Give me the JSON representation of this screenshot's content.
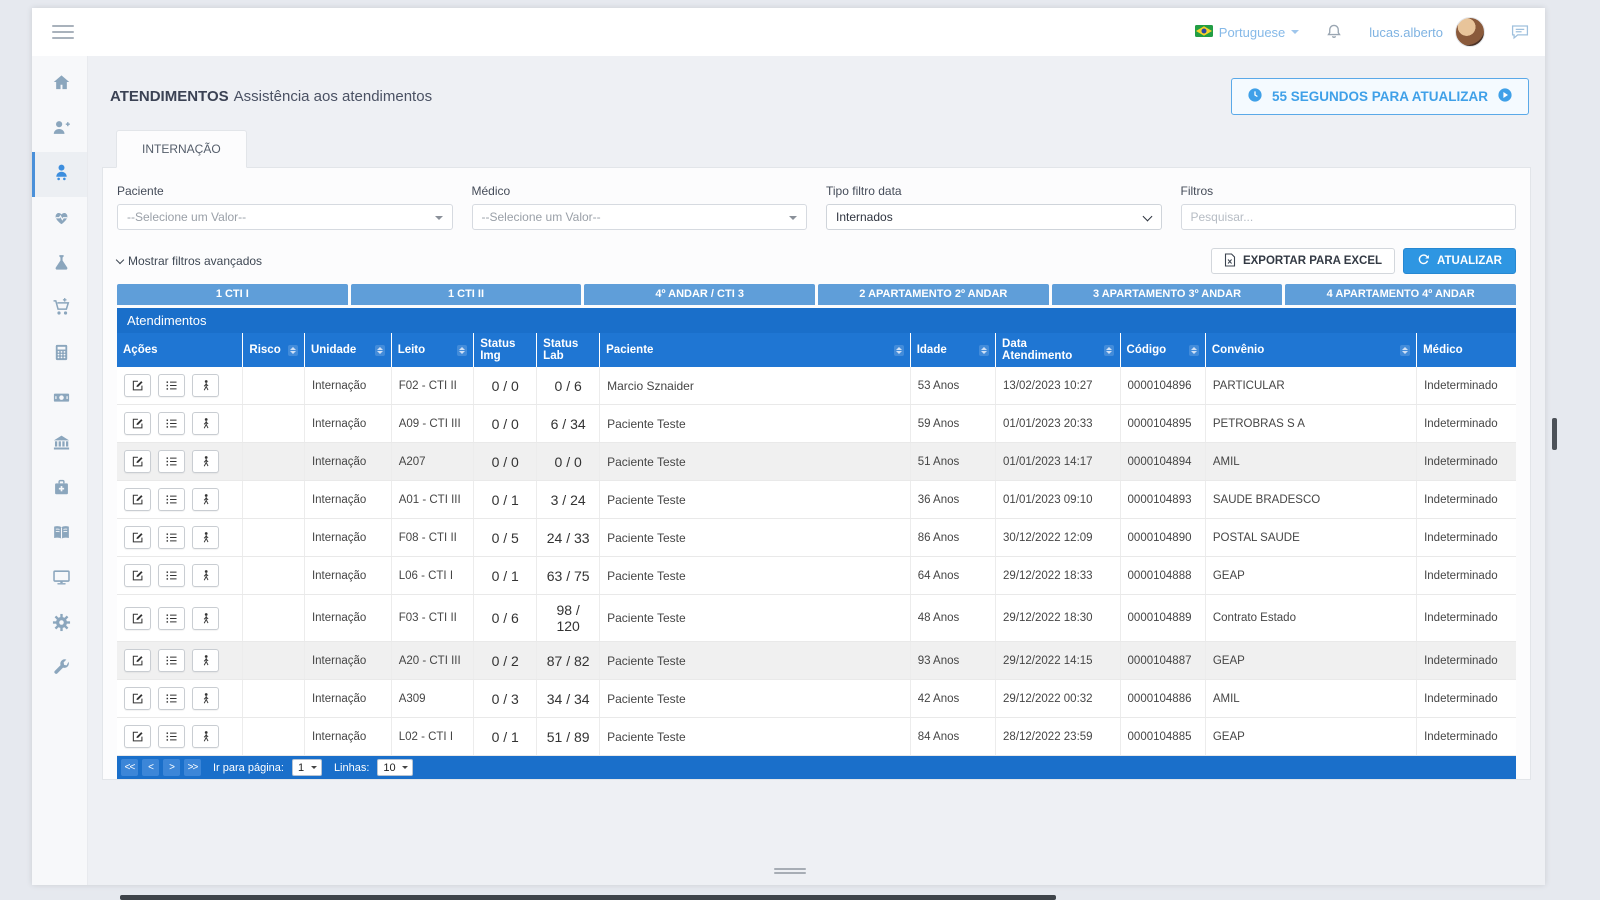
{
  "topbar": {
    "language": "Portuguese",
    "username": "lucas.alberto"
  },
  "page": {
    "title": "ATENDIMENTOS",
    "subtitle": "Assistência aos atendimentos",
    "timer": "55 SEGUNDOS PARA ATUALIZAR"
  },
  "tabs": [
    {
      "label": "INTERNAÇÃO"
    }
  ],
  "filters": {
    "paciente_label": "Paciente",
    "paciente_value": "--Selecione um Valor--",
    "medico_label": "Médico",
    "medico_value": "--Selecione um Valor--",
    "tipo_label": "Tipo filtro data",
    "tipo_value": "Internados",
    "filtros_label": "Filtros",
    "filtros_placeholder": "Pesquisar...",
    "advanced_link": "Mostrar filtros avançados"
  },
  "actions": {
    "export_label": "EXPORTAR PARA EXCEL",
    "refresh_label": "ATUALIZAR"
  },
  "units": [
    "1 CTI I",
    "1 CTI II",
    "4º ANDAR / CTI 3",
    "2 APARTAMENTO 2º ANDAR",
    "3 APARTAMENTO 3º ANDAR",
    "4 APARTAMENTO 4º ANDAR"
  ],
  "table": {
    "caption": "Atendimentos",
    "columns": [
      {
        "label": "Ações",
        "sortable": false
      },
      {
        "label": "Risco",
        "sortable": true
      },
      {
        "label": "Unidade",
        "sortable": true
      },
      {
        "label": "Leito",
        "sortable": true
      },
      {
        "label": "Status Img",
        "sortable": false
      },
      {
        "label": "Status Lab",
        "sortable": false
      },
      {
        "label": "Paciente",
        "sortable": true
      },
      {
        "label": "Idade",
        "sortable": true
      },
      {
        "label": "Data Atendimento",
        "sortable": true
      },
      {
        "label": "Código",
        "sortable": true
      },
      {
        "label": "Convênio",
        "sortable": true
      },
      {
        "label": "Médico",
        "sortable": false
      }
    ],
    "rows": [
      {
        "risco": "",
        "unidade": "Internação",
        "leito": "F02 - CTI II",
        "status_img": "0 / 0",
        "status_lab": "0 / 6",
        "paciente": "Marcio Sznaider",
        "idade": "53 Anos",
        "data": "13/02/2023 10:27",
        "codigo": "0000104896",
        "convenio": "PARTICULAR",
        "medico": "Indeterminado"
      },
      {
        "risco": "",
        "unidade": "Internação",
        "leito": "A09 - CTI III",
        "status_img": "0 / 0",
        "status_lab": "6 / 34",
        "paciente": "Paciente Teste",
        "idade": "59 Anos",
        "data": "01/01/2023 20:33",
        "codigo": "0000104895",
        "convenio": "PETROBRAS S A",
        "medico": "Indeterminado"
      },
      {
        "risco": "",
        "unidade": "Internação",
        "leito": "A207",
        "status_img": "0 / 0",
        "status_lab": "0 / 0",
        "paciente": "Paciente Teste",
        "idade": "51 Anos",
        "data": "01/01/2023 14:17",
        "codigo": "0000104894",
        "convenio": "AMIL",
        "medico": "Indeterminado"
      },
      {
        "risco": "",
        "unidade": "Internação",
        "leito": "A01 - CTI III",
        "status_img": "0 / 1",
        "status_lab": "3 / 24",
        "paciente": "Paciente Teste",
        "idade": "36 Anos",
        "data": "01/01/2023 09:10",
        "codigo": "0000104893",
        "convenio": "SAUDE BRADESCO",
        "medico": "Indeterminado"
      },
      {
        "risco": "",
        "unidade": "Internação",
        "leito": "F08 - CTI II",
        "status_img": "0 / 5",
        "status_lab": "24 / 33",
        "paciente": "Paciente Teste",
        "idade": "86 Anos",
        "data": "30/12/2022 12:09",
        "codigo": "0000104890",
        "convenio": "POSTAL SAUDE",
        "medico": "Indeterminado"
      },
      {
        "risco": "",
        "unidade": "Internação",
        "leito": "L06 - CTI I",
        "status_img": "0 / 1",
        "status_lab": "63 / 75",
        "paciente": "Paciente Teste",
        "idade": "64 Anos",
        "data": "29/12/2022 18:33",
        "codigo": "0000104888",
        "convenio": "GEAP",
        "medico": "Indeterminado"
      },
      {
        "risco": "",
        "unidade": "Internação",
        "leito": "F03 - CTI II",
        "status_img": "0 / 6",
        "status_lab": "98 / 120",
        "paciente": "Paciente Teste",
        "idade": "48 Anos",
        "data": "29/12/2022 18:30",
        "codigo": "0000104889",
        "convenio": "Contrato Estado",
        "medico": "Indeterminado"
      },
      {
        "risco": "",
        "unidade": "Internação",
        "leito": "A20 - CTI III",
        "status_img": "0 / 2",
        "status_lab": "87 / 82",
        "paciente": "Paciente Teste",
        "idade": "93 Anos",
        "data": "29/12/2022 14:15",
        "codigo": "0000104887",
        "convenio": "GEAP",
        "medico": "Indeterminado"
      },
      {
        "risco": "",
        "unidade": "Internação",
        "leito": "A309",
        "status_img": "0 / 3",
        "status_lab": "34 / 34",
        "paciente": "Paciente Teste",
        "idade": "42 Anos",
        "data": "29/12/2022 00:32",
        "codigo": "0000104886",
        "convenio": "AMIL",
        "medico": "Indeterminado"
      },
      {
        "risco": "",
        "unidade": "Internação",
        "leito": "L02 - CTI I",
        "status_img": "0 / 1",
        "status_lab": "51 / 89",
        "paciente": "Paciente Teste",
        "idade": "84 Anos",
        "data": "28/12/2022 23:59",
        "codigo": "0000104885",
        "convenio": "GEAP",
        "medico": "Indeterminado"
      }
    ]
  },
  "pagination": {
    "first": "<<",
    "prev": "<",
    "next": ">",
    "last": ">>",
    "go_label": "Ir para página:",
    "page_value": "1",
    "lines_label": "Linhas:",
    "lines_value": "10"
  },
  "sidebar": {
    "items": [
      "home",
      "user-add",
      "attendances",
      "heartbeat",
      "laboratory-flask",
      "purchases-cart",
      "calculator",
      "money",
      "bank",
      "hospital-case",
      "reports-book",
      "monitor",
      "settings-gear",
      "maintenance-wrench"
    ],
    "active": "attendances"
  },
  "icons": {
    "menu": "hamburger-icon",
    "language": "brazil-flag-icon",
    "notifications": "bell-icon",
    "messages": "chat-bubble-icon",
    "timer": "clock-icon",
    "timer_go": "play-circle-icon",
    "export": "excel-file-icon",
    "refresh": "refresh-icon",
    "sort": "sort-arrows-icon",
    "row_actions": [
      "edit-icon",
      "list-check-icon",
      "person-icon"
    ]
  }
}
